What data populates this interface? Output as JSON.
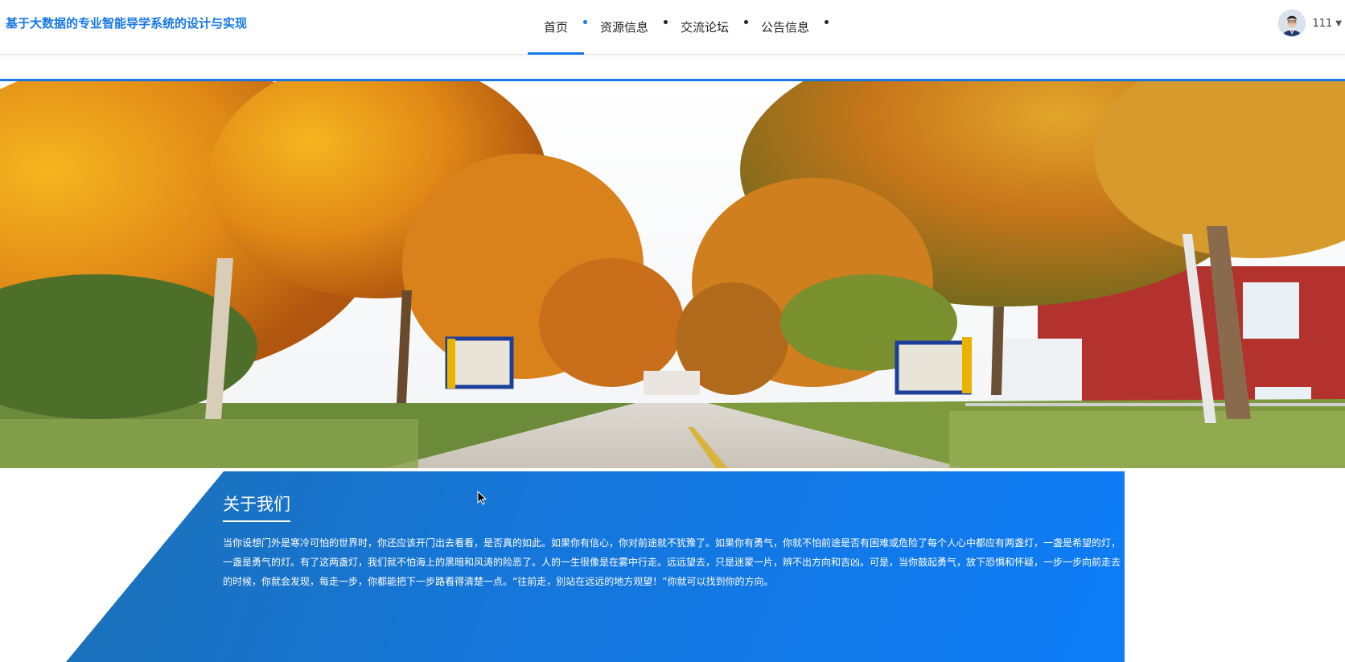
{
  "site": {
    "title": "基于大数据的专业智能导学系统的设计与实现"
  },
  "nav": {
    "items": [
      {
        "label": "首页",
        "active": true
      },
      {
        "label": "资源信息",
        "active": false
      },
      {
        "label": "交流论坛",
        "active": false
      },
      {
        "label": "公告信息",
        "active": false
      }
    ]
  },
  "user": {
    "name": "111",
    "avatar": "avatar-icon",
    "dropdown_icon": "caret-down-icon"
  },
  "banner": {
    "image": "autumn tree-lined campus road",
    "slide_count": 2,
    "active_slide": 1
  },
  "about": {
    "title": "关于我们",
    "text": "当你设想门外是寒冷可怕的世界时，你还应该开门出去看看，是否真的如此。如果你有信心，你对前途就不犹豫了。如果你有勇气，你就不怕前途是否有困难或危险了每个人心中都应有两盏灯，一盏是希望的灯，一盏是勇气的灯。有了这两盏灯，我们就不怕海上的黑暗和风涛的险恶了。人的一生很像是在雾中行走。远远望去，只是迷蒙一片，辨不出方向和吉凶。可是，当你鼓起勇气，放下恐惧和怀疑，一步一步向前走去的时候，你就会发现，每走一步，你都能把下一步路看得清楚一点。“往前走，别站在远远的地方观望！”你就可以找到你的方向。"
  },
  "colors": {
    "accent": "#1677e6",
    "about_bg": "#0d7cf7"
  }
}
